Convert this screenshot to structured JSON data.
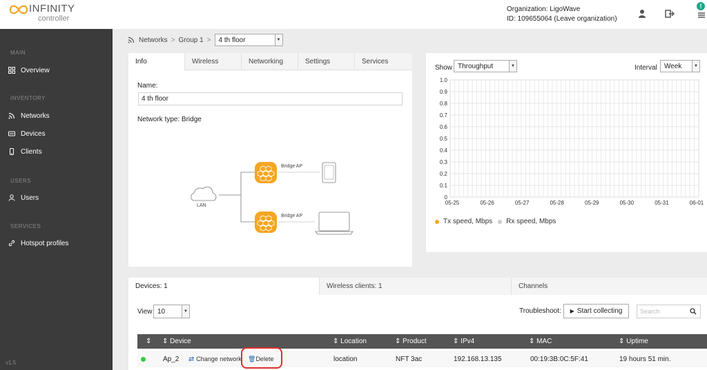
{
  "header": {
    "logo_name": "INFINITY",
    "logo_sub": "controller",
    "org_name": "Organization: LigoWave",
    "org_id": "ID: 109655064 (Leave organization)",
    "notif_count": "!"
  },
  "sidebar": {
    "sections": [
      {
        "title": "MAIN",
        "items": [
          {
            "label": "Overview",
            "icon": "grid-icon"
          }
        ]
      },
      {
        "title": "INVENTORY",
        "items": [
          {
            "label": "Networks",
            "icon": "wifi-icon"
          },
          {
            "label": "Devices",
            "icon": "device-icon"
          },
          {
            "label": "Clients",
            "icon": "phone-icon"
          }
        ]
      },
      {
        "title": "USERS",
        "items": [
          {
            "label": "Users",
            "icon": "user-icon"
          }
        ]
      },
      {
        "title": "SERVICES",
        "items": [
          {
            "label": "Hotspot profiles",
            "icon": "link-icon"
          }
        ]
      }
    ],
    "version": "v1.5"
  },
  "breadcrumb": {
    "root": "Networks",
    "group": "Group 1",
    "sep": ">",
    "current": "4 th floor"
  },
  "info": {
    "tabs": [
      "Info",
      "Wireless",
      "Networking",
      "Settings",
      "Services"
    ],
    "name_label": "Name:",
    "name_value": "4 th floor",
    "network_type": "Network type: Bridge",
    "diagram": {
      "lan": "LAN",
      "ap1": "Bridge AP",
      "ap2": "Bridge AP"
    }
  },
  "chart": {
    "show_label": "Show",
    "show_value": "Throughput",
    "interval_label": "Interval",
    "interval_value": "Week"
  },
  "chart_data": {
    "type": "line",
    "x": [
      "05-25",
      "05-26",
      "05-27",
      "05-28",
      "05-29",
      "05-30",
      "05-31",
      "06-01"
    ],
    "ylim": [
      0,
      1.0
    ],
    "yticks": [
      "1.0",
      "0.9",
      "0.8",
      "0.7",
      "0.6",
      "0.5",
      "0.4",
      "0.3",
      "0.2",
      "0.1",
      "0"
    ],
    "grid": true,
    "series": [
      {
        "name": "Tx speed, Mbps",
        "color": "#f5a623",
        "values": []
      },
      {
        "name": "Rx speed, Mbps",
        "color": "#cccccc",
        "values": []
      }
    ]
  },
  "devices": {
    "tabs": [
      "Devices: 1",
      "Wireless clients: 1",
      "Channels"
    ],
    "view_label": "View",
    "view_value": "10",
    "troubleshoot_label": "Troubleshoot:",
    "start_label": "Start collecting",
    "search_placeholder": "Search",
    "columns": [
      "Device",
      "Location",
      "Product",
      "IPv4",
      "MAC",
      "Uptime"
    ],
    "rows": [
      {
        "status_color": "#2ecc40",
        "device": "Ap_2",
        "change": "Change network",
        "delete": "Delete",
        "location": "location",
        "product": "NFT 3ac",
        "ipv4": "192.168.13.135",
        "mac": "00:19:3B:0C:5F:41",
        "uptime": "19 hours 51 min."
      }
    ]
  }
}
